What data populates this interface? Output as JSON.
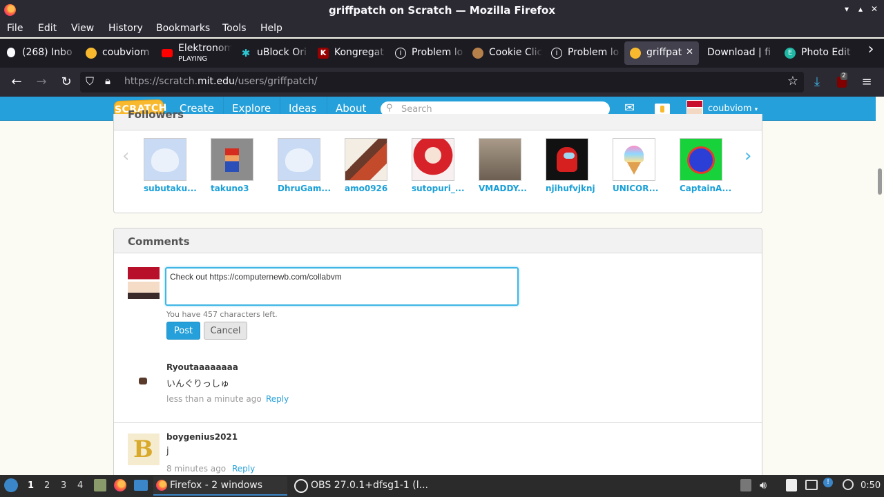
{
  "window": {
    "title": "griffpatch on Scratch — Mozilla Firefox",
    "minimize_glyph": "▾",
    "maximize_glyph": "▴",
    "close_glyph": "✕"
  },
  "menu": [
    "File",
    "Edit",
    "View",
    "History",
    "Bookmarks",
    "Tools",
    "Help"
  ],
  "tabs": [
    {
      "label": "(268) Inbo",
      "icon": "mail-icon"
    },
    {
      "label": "coubviom",
      "icon": "scratch-icon"
    },
    {
      "label": "Elektronom",
      "sub": "PLAYING",
      "icon": "youtube-icon"
    },
    {
      "label": "uBlock Ori",
      "icon": "ublock-icon"
    },
    {
      "label": "Kongregat",
      "icon": "kongregate-icon"
    },
    {
      "label": "Problem lo",
      "icon": "info-icon"
    },
    {
      "label": "Cookie Clic",
      "icon": "cookie-icon"
    },
    {
      "label": "Problem lo",
      "icon": "info-icon"
    },
    {
      "label": "griffpatch",
      "icon": "scratch-icon",
      "active": true
    },
    {
      "label": "Download | fi",
      "icon": ""
    },
    {
      "label": "Photo Edit",
      "icon": "photo-editor-icon"
    }
  ],
  "tab_close_glyph": "✕",
  "new_tab_glyph": "›",
  "nav": {
    "url_prefix": "https://scratch.",
    "url_domain": "mit.edu",
    "url_path": "/users/griffpatch/",
    "extension_badge": "2"
  },
  "scratch": {
    "logo": "SCRATCH",
    "nav": [
      "Create",
      "Explore",
      "Ideas",
      "About"
    ],
    "search_placeholder": "Search",
    "username": "coubviom",
    "user_caret": "▾"
  },
  "followers": {
    "heading": "Followers",
    "prev_arrow": "‹",
    "next_arrow": "›",
    "items": [
      {
        "name": "subutaku...",
        "color": "#c9dbf4"
      },
      {
        "name": "takuno3",
        "color": "#8c8c8c"
      },
      {
        "name": "DhruGam...",
        "color": "#c9dbf4"
      },
      {
        "name": "amo0926",
        "color": "#d9c6b3"
      },
      {
        "name": "sutopuri_...",
        "color": "#f2d0d0"
      },
      {
        "name": "VMADDY...",
        "color": "#8d7f70"
      },
      {
        "name": "njihufvjknj",
        "color": "#111111"
      },
      {
        "name": "UNICOR...",
        "color": "#ffffff"
      },
      {
        "name": "CaptainA...",
        "color": "#18d23c"
      }
    ]
  },
  "comments": {
    "heading": "Comments",
    "input_value": "Check out https://computernewb.com/collabvm",
    "chars_left": "You have 457 characters left.",
    "post_label": "Post",
    "cancel_label": "Cancel",
    "reply_label": "Reply",
    "list": [
      {
        "user": "Ryoutaaaaaaaa",
        "text": "いんぐりっしゅ",
        "time": "less than a minute ago"
      },
      {
        "user": "boygenius2021",
        "text": "j",
        "time": "8 minutes ago"
      }
    ]
  },
  "taskbar": {
    "workspaces": [
      "1",
      "2",
      "3",
      "4"
    ],
    "tasks": [
      {
        "label": "Firefox - 2 windows",
        "active": true
      },
      {
        "label": "OBS 27.0.1+dfsg1-1 (l...",
        "active": false
      }
    ],
    "tray_badge": "!",
    "clock": "0:50"
  }
}
